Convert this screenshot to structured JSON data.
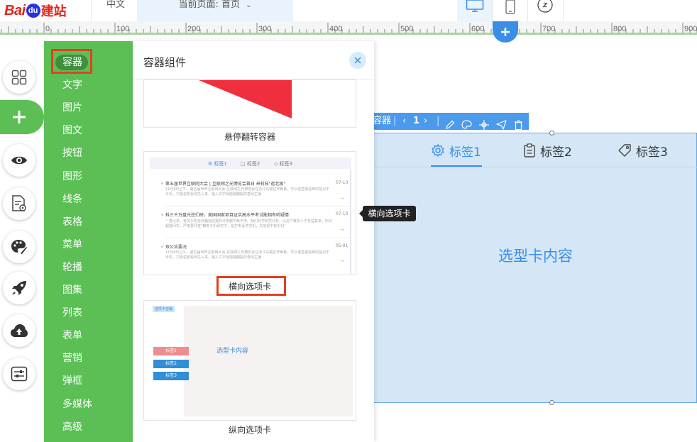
{
  "brand": {
    "logo_left": "Bai",
    "logo_paw": "du",
    "logo_right": "建站",
    "color_red": "#e1251b",
    "color_blue": "#2932e1"
  },
  "header": {
    "language": "中文",
    "current_page": "当前页面: 首页",
    "devices": [
      "desktop-icon",
      "mobile-icon",
      "link-icon"
    ]
  },
  "ruler": {
    "ticks": [
      "0",
      "100",
      "200",
      "300",
      "400",
      "500",
      "600",
      "700",
      "800",
      "900"
    ]
  },
  "tools": [
    "grid-icon",
    "plus-icon",
    "eye-icon",
    "page-settings-icon",
    "palette-icon",
    "rocket-icon",
    "cloud-upload-icon",
    "sliders-icon"
  ],
  "categories": {
    "active": "容器",
    "items": [
      "容器",
      "文字",
      "图片",
      "图文",
      "按钮",
      "图形",
      "线条",
      "表格",
      "菜单",
      "轮播",
      "图集",
      "列表",
      "表单",
      "营销",
      "弹框",
      "多媒体",
      "高级"
    ]
  },
  "panel": {
    "title": "容器组件",
    "cards": [
      {
        "label": "悬停翻转容器"
      },
      {
        "label": "横向选项卡",
        "preview": {
          "tabs": [
            "标签1",
            "标签2",
            "标签3"
          ],
          "rows": [
            {
              "title": "第五届世界互联网大会 | 互联网之光博览会首日 来科技\"逛北极\"",
              "text": "11月8日上午，第五届世界互联网大会·互联网之光博览会在浙江乌镇拉开帷幕。可以很直接看到的是对于手机，只需说想看何先入来，输入文字就能翻翻般的查阅主播",
              "date": "07-10"
            },
            {
              "title": "科三千万盘光控们研，美国国家项目证实高水平考试能相有听疑情",
              "text": "一直以来，有关手机检测偏远情报的分类都不断干净。我们科学研究分析，以全户赛多人于日益其来，所对超越问实，严格要评查\"精英手机研究方，临打电话凭实机，先地很不稳手机\"",
              "date": "07-10"
            },
            {
              "title": "双公告要况",
              "text": "11月8日上午，第五届世界互联网大会·互联网之光博览会在浙江乌镇拉开帷幕。可以很直接看到的是对于手机，只需说想看何先入来，输入文字就能翻翻般的查阅主播",
              "date": "05-01"
            }
          ]
        }
      },
      {
        "label": "纵向选项卡",
        "preview": {
          "badge": "选项卡容器",
          "tabs": [
            "标签1",
            "标签2",
            "标签3"
          ],
          "content": "选型卡内容",
          "tab_colors": [
            "#f08c8c",
            "#2f8fd8",
            "#2f8fd8"
          ]
        }
      }
    ]
  },
  "tooltip": "横向选项卡",
  "selected_component": {
    "toolbar_name": "容器",
    "page_index": "1",
    "toolbar_icons": [
      "edit-icon",
      "style-icon",
      "move-icon",
      "send-icon",
      "trash-icon"
    ],
    "tabs": [
      {
        "label": "标签1",
        "icon": "gear-icon"
      },
      {
        "label": "标签2",
        "icon": "clipboard-icon"
      },
      {
        "label": "标签3",
        "icon": "tag-icon"
      }
    ],
    "content": "选型卡内容",
    "accent": "#3a8ee6"
  }
}
